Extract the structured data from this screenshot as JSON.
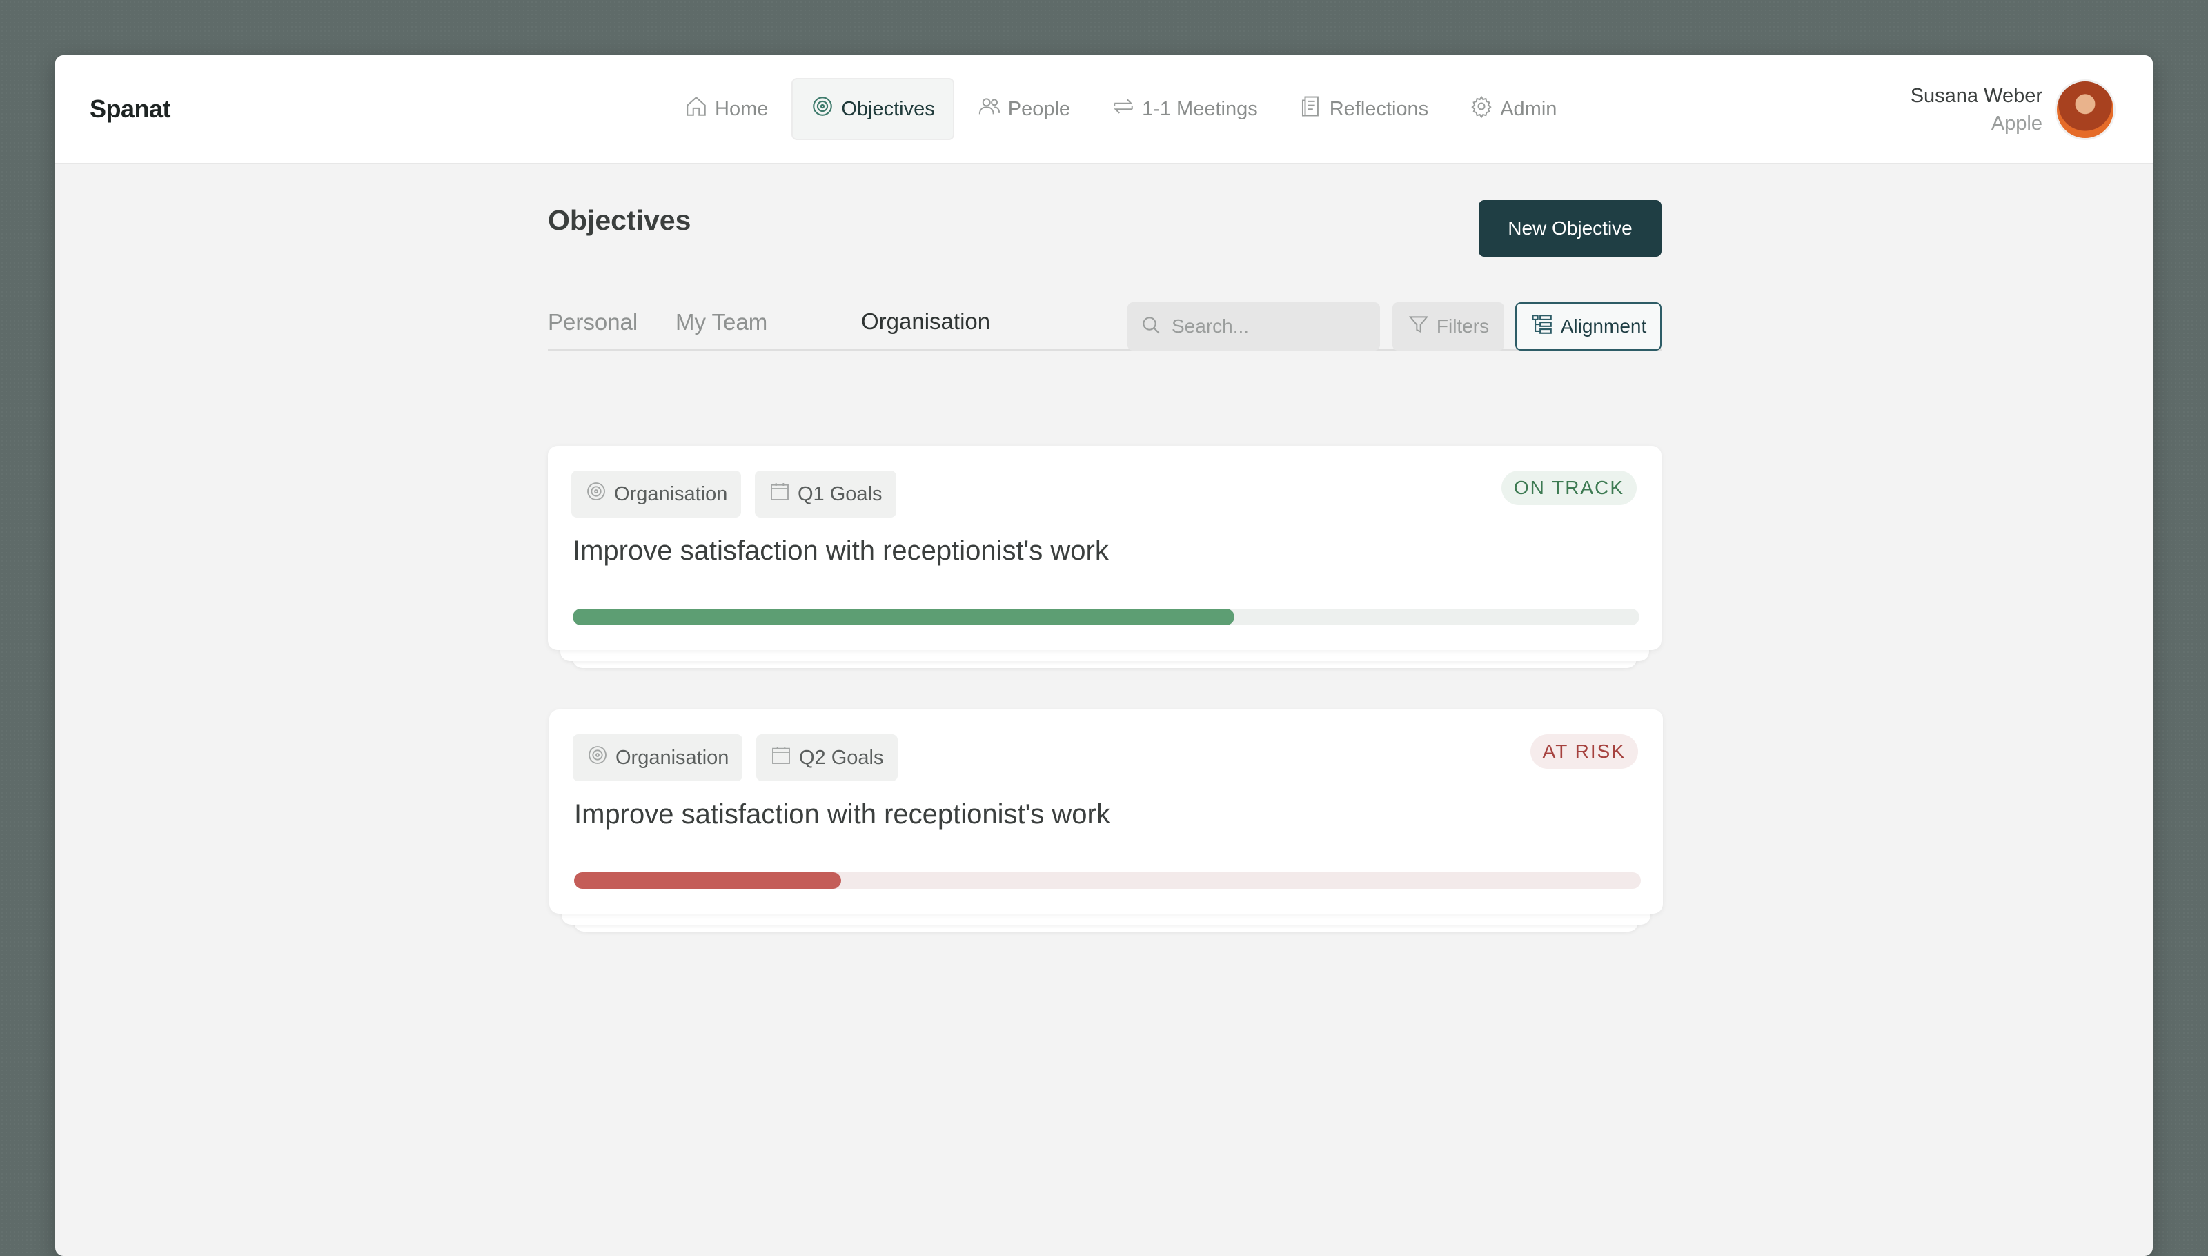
{
  "app": {
    "name": "Spanat"
  },
  "nav": {
    "items": [
      {
        "label": "Home",
        "icon": "home-icon",
        "active": false
      },
      {
        "label": "Objectives",
        "icon": "target-icon",
        "active": true
      },
      {
        "label": "People",
        "icon": "people-icon",
        "active": false
      },
      {
        "label": "1-1 Meetings",
        "icon": "arrows-swap-icon",
        "active": false
      },
      {
        "label": "Reflections",
        "icon": "document-icon",
        "active": false
      },
      {
        "label": "Admin",
        "icon": "gear-icon",
        "active": false
      }
    ]
  },
  "user": {
    "name": "Susana Weber",
    "org": "Apple"
  },
  "page": {
    "title": "Objectives",
    "new_button": "New Objective",
    "tabs": [
      {
        "label": "Personal",
        "active": false
      },
      {
        "label": "My Team",
        "active": false
      },
      {
        "label": "Organisation",
        "active": true
      }
    ],
    "search_placeholder": "Search...",
    "filters_label": "Filters",
    "alignment_label": "Alignment"
  },
  "objectives": [
    {
      "scope": "Organisation",
      "period": "Q1 Goals",
      "title": "Improve satisfaction with receptionist's work",
      "status": "ON TRACK",
      "progress_percent": 62,
      "color": "#5d9e73",
      "track_color": "#edf0ee"
    },
    {
      "scope": "Organisation",
      "period": "Q2 Goals",
      "title": "Improve satisfaction with receptionist's work",
      "status": "AT RISK",
      "progress_percent": 25,
      "color": "#c45d58",
      "track_color": "#f3eaea"
    }
  ],
  "colors": {
    "primary": "#1f3e44",
    "on_track": "#5d9e73",
    "at_risk": "#c45d58"
  }
}
